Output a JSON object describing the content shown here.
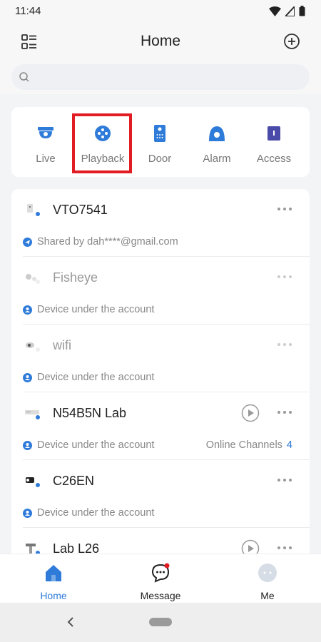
{
  "status_bar": {
    "time": "11:44",
    "icons": [
      "wifi-icon",
      "signal-icon",
      "battery-icon"
    ]
  },
  "header": {
    "title": "Home",
    "menu_icon": "list-icon",
    "add_icon": "plus-circle-icon"
  },
  "search": {
    "placeholder": "",
    "icon": "search-icon"
  },
  "quick_access": [
    {
      "label": "Live",
      "icon": "camera-dome-icon"
    },
    {
      "label": "Playback",
      "icon": "playback-icon",
      "highlighted": true
    },
    {
      "label": "Door",
      "icon": "door-station-icon"
    },
    {
      "label": "Alarm",
      "icon": "alarm-icon"
    },
    {
      "label": "Access",
      "icon": "access-control-icon"
    }
  ],
  "devices": [
    {
      "name": "VTO7541",
      "sub": "Shared by dah****@gmail.com",
      "online": true,
      "playback": false
    },
    {
      "name": "Fisheye",
      "sub": "Device under the account",
      "online": false,
      "playback": false
    },
    {
      "name": "wifi",
      "sub": "Device under the account",
      "online": false,
      "playback": false
    },
    {
      "name": "N54B5N Lab",
      "sub": "Device under the account",
      "online": true,
      "playback": true,
      "channels_label": "Online Channels",
      "channels_count": "4"
    },
    {
      "name": "C26EN",
      "sub": "Device under the account",
      "online": true,
      "playback": false
    },
    {
      "name": "Lab L26",
      "sub": "",
      "online": true,
      "playback": true
    }
  ],
  "tab_bar": [
    {
      "label": "Home",
      "icon": "home-icon",
      "active": true
    },
    {
      "label": "Message",
      "icon": "message-icon",
      "active": false
    },
    {
      "label": "Me",
      "icon": "profile-icon",
      "active": false
    }
  ],
  "colors": {
    "accent": "#2f7bd9",
    "highlight": "#e21c23",
    "page_bg": "#f3f4f6"
  }
}
